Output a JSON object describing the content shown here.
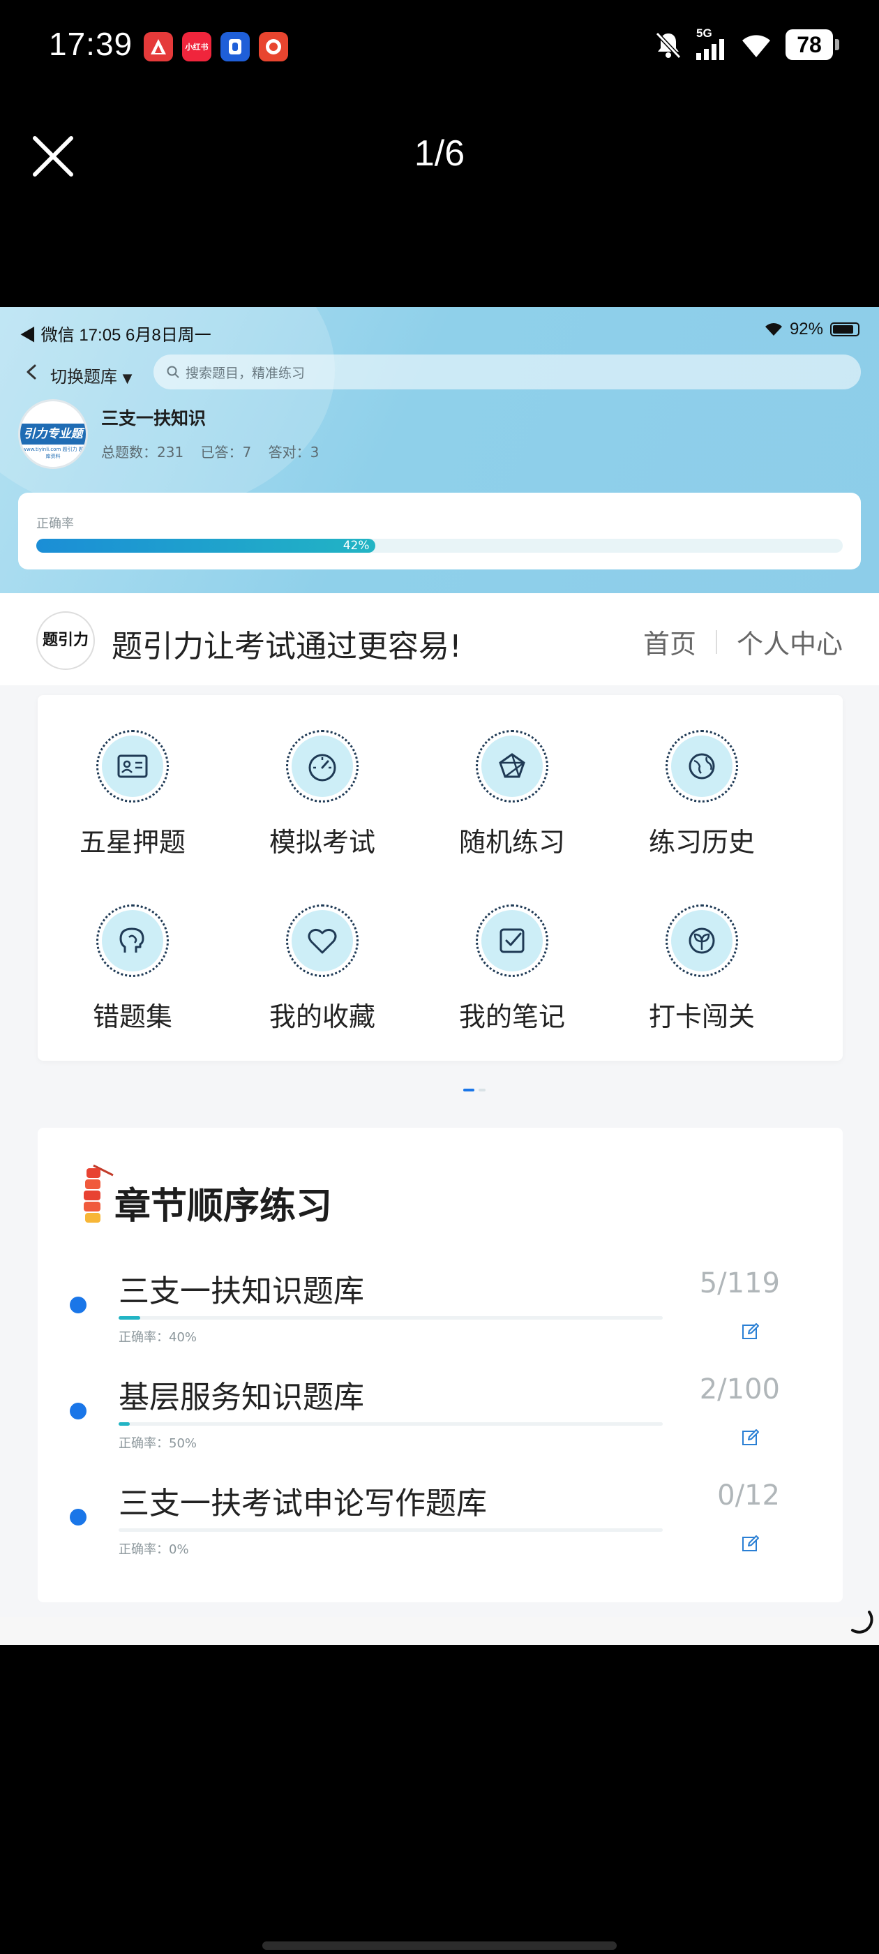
{
  "status_bar": {
    "time": "17:39",
    "battery": "78",
    "network": "5G",
    "apps": [
      {
        "name": "A",
        "color": "#e53a3a"
      },
      {
        "name": "小红书",
        "color": "#f0253c"
      },
      {
        "name": "0",
        "color": "#1f5fd8"
      },
      {
        "name": "券",
        "color": "#e8452f"
      }
    ]
  },
  "viewer": {
    "counter": "1/6"
  },
  "screenshot": {
    "status": {
      "left": "◀ 微信   17:05   6月8日周一",
      "wifi_battery": "92%"
    },
    "nav": {
      "switch_label": "切换题库",
      "search_placeholder": "搜索题目，精准练习"
    },
    "course": {
      "logo_text": "引力专业题",
      "logo_sub": "www.tiyinli.com  题引力 题库资料",
      "title": "三支一扶知识",
      "total_label": "总题数：231",
      "answered_label": "已答：7",
      "correct_label": "答对：3"
    },
    "accuracy": {
      "label": "正确率",
      "percent_text": "42%",
      "value": 0.42
    },
    "banner": {
      "logo_text": "题引力",
      "slogan": "题引力让考试通过更容易!",
      "nav_home": "首页",
      "nav_profile": "个人中心"
    },
    "features": [
      {
        "label": "五星押题",
        "icon": "id-card-icon"
      },
      {
        "label": "模拟考试",
        "icon": "speedometer-icon"
      },
      {
        "label": "随机练习",
        "icon": "network-icon"
      },
      {
        "label": "练习历史",
        "icon": "globe-icon"
      },
      {
        "label": "错题集",
        "icon": "brain-head-icon"
      },
      {
        "label": "我的收藏",
        "icon": "heart-icon"
      },
      {
        "label": "我的笔记",
        "icon": "note-check-icon"
      },
      {
        "label": "打卡闯关",
        "icon": "sprout-icon"
      }
    ],
    "chapters": {
      "title": "章节顺序练习",
      "items": [
        {
          "name": "三支一扶知识题库",
          "count": "5/119",
          "accuracy": "正确率：40%",
          "progress": 0.04
        },
        {
          "name": "基层服务知识题库",
          "count": "2/100",
          "accuracy": "正确率：50%",
          "progress": 0.02
        },
        {
          "name": "三支一扶考试申论写作题库",
          "count": "0/12",
          "accuracy": "正确率：0%",
          "progress": 0
        }
      ]
    }
  }
}
